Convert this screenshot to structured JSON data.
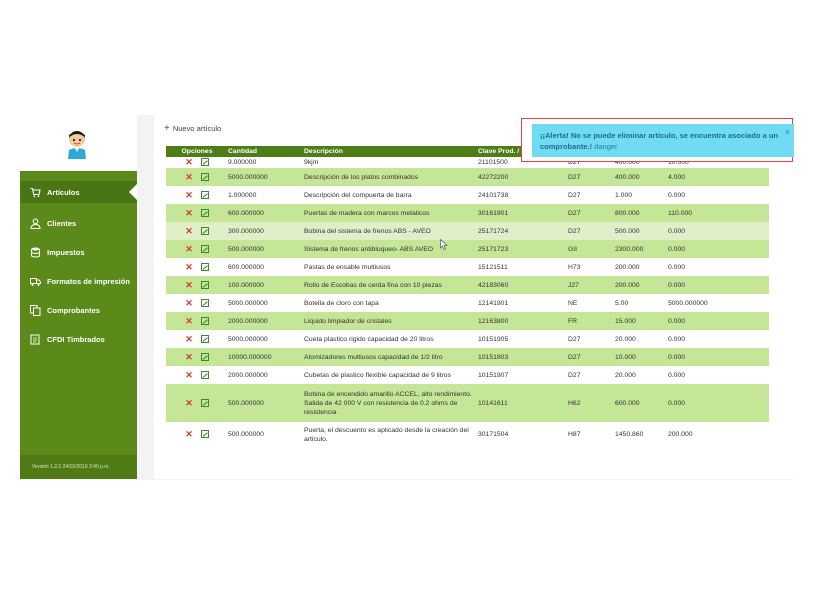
{
  "sidebar": {
    "items": [
      {
        "label": "Artículos",
        "icon": "cart-icon",
        "active": true
      },
      {
        "label": "Clientes",
        "icon": "user-icon",
        "active": false
      },
      {
        "label": "Impuestos",
        "icon": "database-icon",
        "active": false
      },
      {
        "label": "Formatos de impresión",
        "icon": "truck-icon",
        "active": false
      },
      {
        "label": "Comprobantes",
        "icon": "copy-icon",
        "active": false
      },
      {
        "label": "CFDI Timbrados",
        "icon": "document-icon",
        "active": false
      }
    ],
    "version": "Versión 1.2.0 24/10/2019 3:40 p.m."
  },
  "main": {
    "new_article": "Nuevo artículo"
  },
  "table": {
    "headers": [
      "Opciones",
      "Cantidad",
      "Descripción",
      "Clave Prod. / Serv",
      "",
      "",
      ""
    ],
    "rows": [
      {
        "cantidad": "9.000000",
        "descripcion": "9kjm",
        "clave": "21101500",
        "unidad": "D27",
        "precio": "400.000",
        "importe": "10.000"
      },
      {
        "cantidad": "5000.000000",
        "descripcion": "Descripción de los platos combinados",
        "clave": "42272200",
        "unidad": "D27",
        "precio": "400.000",
        "importe": "4.000"
      },
      {
        "cantidad": "1.000000",
        "descripcion": "Descripción del compuerta de barra",
        "clave": "24101738",
        "unidad": "D27",
        "precio": "1.000",
        "importe": "0.000"
      },
      {
        "cantidad": "600.000000",
        "descripcion": "Puertas de madera con marcos metalicos",
        "clave": "30161901",
        "unidad": "D27",
        "precio": "800.000",
        "importe": "110.000"
      },
      {
        "cantidad": "300.000000",
        "descripcion": "Bobina del sistema de frenos ABS - AVEO",
        "clave": "25171724",
        "unidad": "D27",
        "precio": "500.000",
        "importe": "0.000"
      },
      {
        "cantidad": "500.000000",
        "descripcion": "Sistema de frenos antibloqueo- ABS AVEO",
        "clave": "25171723",
        "unidad": "GII",
        "precio": "2300.000",
        "importe": "0.000"
      },
      {
        "cantidad": "600.000000",
        "descripcion": "Pastas de ensable multiusos",
        "clave": "15121511",
        "unidad": "H73",
        "precio": "200.000",
        "importe": "0.000"
      },
      {
        "cantidad": "100.000000",
        "descripcion": "Rollo de Escobas de cerda fina con 10 piezas",
        "clave": "42183060",
        "unidad": "J27",
        "precio": "200.000",
        "importe": "0.000"
      },
      {
        "cantidad": "5000.000000",
        "descripcion": "Botella de cloro con tapa",
        "clave": "12141901",
        "unidad": "NE",
        "precio": "5.00",
        "importe": "5000.000000"
      },
      {
        "cantidad": "2000.000000",
        "descripcion": "Liquido limpiador de cristales",
        "clave": "12163800",
        "unidad": "FR",
        "precio": "15.000",
        "importe": "0.000"
      },
      {
        "cantidad": "5000.000000",
        "descripcion": "Cueta plastico rigido capacidad de 20 litros",
        "clave": "10151905",
        "unidad": "D27",
        "precio": "20.000",
        "importe": "0.000"
      },
      {
        "cantidad": "10000.000000",
        "descripcion": "Atomizadores multiusos capacidad de 1/2 litro",
        "clave": "10151803",
        "unidad": "D27",
        "precio": "10.000",
        "importe": "0.000"
      },
      {
        "cantidad": "2000.000000",
        "descripcion": "Cubetas de plastico flexible capacidad de 9 litros",
        "clave": "10151907",
        "unidad": "D27",
        "precio": "20.000",
        "importe": "0.000"
      },
      {
        "cantidad": "500.000000",
        "descripcion": "Bobina de encendido amarillo ACCEL, alto rendimiento. Salida de 42 000 V con resistencia de 0.2 ohms de resistencia",
        "clave": "10141611",
        "unidad": "H62",
        "precio": "600.000",
        "importe": "0.000"
      },
      {
        "cantidad": "500.000000",
        "descripcion": "Puerta, el descuento es aplicado desde la creación del articulo.",
        "clave": "30171504",
        "unidad": "H87",
        "precio": "1450.860",
        "importe": "200.000"
      }
    ]
  },
  "alert": {
    "title": "¡¡Alerta! No se puede eliminar artículo, se encuentra asociado a un comprobante.!",
    "tag": "danger",
    "close": "×"
  },
  "colors": {
    "sidebar": "#5b8a1b",
    "header": "#4f7d17",
    "row_alt": "#c5e597",
    "alert_bg": "#6fdcf3",
    "alert_border": "#e84040"
  }
}
